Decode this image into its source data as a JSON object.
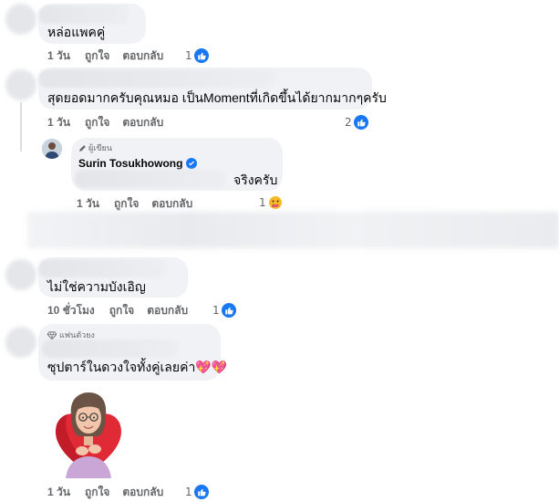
{
  "comments": [
    {
      "text": "หล่อแพคคู่",
      "time": "1 วัน",
      "like_label": "ถูกใจ",
      "reply_label": "ตอบกลับ",
      "reaction_count": "1",
      "reaction_icon": "like-icon"
    },
    {
      "text": "สุดยอดมากครับคุณหมอ เป็นMomentที่เกิดขึ้นได้ยากมากๆครับ",
      "time": "1 วัน",
      "like_label": "ถูกใจ",
      "reply_label": "ตอบกลับ",
      "reaction_count": "2",
      "reaction_icon": "like-icon"
    },
    {
      "badge": "ผู้เขียน",
      "badge_icon": "pencil-icon",
      "author": "Surin Tosukhowong",
      "verified_icon": "verified-badge-icon",
      "text": "จริงครับ",
      "time": "1 วัน",
      "like_label": "ถูกใจ",
      "reply_label": "ตอบกลับ",
      "reaction_count": "1",
      "reaction_icon": "care-emoji-icon"
    },
    {
      "text": "ไม่ใช่ความบังเอิญ",
      "time": "10 ชั่วโมง",
      "like_label": "ถูกใจ",
      "reply_label": "ตอบกลับ",
      "reaction_count": "1",
      "reaction_icon": "like-icon"
    },
    {
      "badge": "แฟนตัวยง",
      "badge_icon": "diamond-icon",
      "text": "ซุปตาร์ในดวงใจทั้งคู่เลยค่า💖💖",
      "sticker": "avatar-heart-sticker",
      "time": "1 วัน",
      "like_label": "ถูกใจ",
      "reply_label": "ตอบกลับ",
      "reaction_count": "1",
      "reaction_icon": "like-icon"
    }
  ],
  "colors": {
    "bubble": "#f0f2f5",
    "meta_text": "#65676b",
    "accent_blue": "#1877f2"
  }
}
